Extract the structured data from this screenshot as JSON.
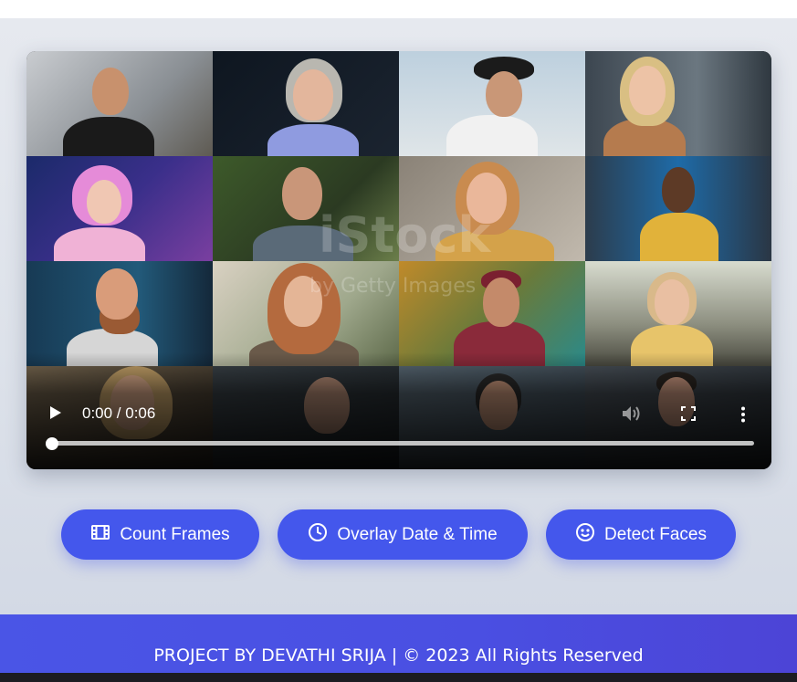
{
  "video": {
    "time_display": "0:00 / 0:06",
    "progress": 0,
    "watermark_text": "iStock",
    "watermark_credit": "by Getty Images"
  },
  "buttons": {
    "count_frames": "Count Frames",
    "overlay_datetime": "Overlay Date & Time",
    "detect_faces": "Detect Faces"
  },
  "icons": {
    "count_frames": "film-icon",
    "overlay_datetime": "clock-icon",
    "detect_faces": "smile-icon"
  },
  "footer": {
    "text": "PROJECT BY DEVATHI SRIJA | © 2023 All Rights Reserved"
  },
  "colors": {
    "accent": "#4457ec",
    "footer": "#4a55e6"
  }
}
